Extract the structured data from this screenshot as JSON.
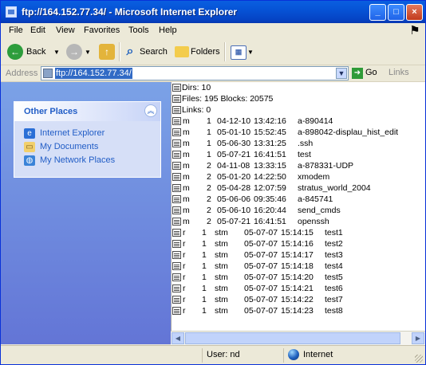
{
  "window": {
    "title": "ftp://164.152.77.34/ - Microsoft Internet Explorer"
  },
  "title_buttons": {
    "minimize": "_",
    "maximize": "□",
    "close": "×"
  },
  "menu": {
    "file": "File",
    "edit": "Edit",
    "view": "View",
    "favorites": "Favorites",
    "tools": "Tools",
    "help": "Help"
  },
  "toolbar": {
    "back": "Back",
    "search": "Search",
    "folders": "Folders"
  },
  "address": {
    "label": "Address",
    "value": "ftp://164.152.77.34/",
    "go": "Go",
    "links": "Links"
  },
  "left_panel": {
    "title": "Other Places",
    "links": [
      {
        "label": "Internet Explorer",
        "icon": "internet-explorer-icon"
      },
      {
        "label": "My Documents",
        "icon": "my-documents-icon"
      },
      {
        "label": "My Network Places",
        "icon": "network-places-icon"
      }
    ]
  },
  "listing": {
    "header_lines": [
      "Dirs: 10",
      "Files: 195  Blocks: 20575",
      "Links: 0"
    ],
    "entries": [
      {
        "type": "m",
        "count": "1",
        "owner": "",
        "date": "04-12-10",
        "time": "13:42:16",
        "name": "a-890414"
      },
      {
        "type": "m",
        "count": "1",
        "owner": "",
        "date": "05-01-10",
        "time": "15:52:45",
        "name": "a-898042-displau_hist_edit"
      },
      {
        "type": "m",
        "count": "1",
        "owner": "",
        "date": "05-06-30",
        "time": "13:31:25",
        "name": ".ssh"
      },
      {
        "type": "m",
        "count": "1",
        "owner": "",
        "date": "05-07-21",
        "time": "16:41:51",
        "name": "test"
      },
      {
        "type": "m",
        "count": "2",
        "owner": "",
        "date": "04-11-08",
        "time": "13:33:15",
        "name": "a-878331-UDP"
      },
      {
        "type": "m",
        "count": "2",
        "owner": "",
        "date": "05-01-20",
        "time": "14:22:50",
        "name": "xmodem"
      },
      {
        "type": "m",
        "count": "2",
        "owner": "",
        "date": "05-04-28",
        "time": "12:07:59",
        "name": "stratus_world_2004"
      },
      {
        "type": "m",
        "count": "2",
        "owner": "",
        "date": "05-06-06",
        "time": "09:35:46",
        "name": "a-845741"
      },
      {
        "type": "m",
        "count": "2",
        "owner": "",
        "date": "05-06-10",
        "time": "16:20:44",
        "name": "send_cmds"
      },
      {
        "type": "m",
        "count": "2",
        "owner": "",
        "date": "05-07-21",
        "time": "16:41:51",
        "name": "openssh"
      },
      {
        "type": "r",
        "count": "1",
        "owner": "stm",
        "date": "05-07-07",
        "time": "15:14:15",
        "name": "test1"
      },
      {
        "type": "r",
        "count": "1",
        "owner": "stm",
        "date": "05-07-07",
        "time": "15:14:16",
        "name": "test2"
      },
      {
        "type": "r",
        "count": "1",
        "owner": "stm",
        "date": "05-07-07",
        "time": "15:14:17",
        "name": "test3"
      },
      {
        "type": "r",
        "count": "1",
        "owner": "stm",
        "date": "05-07-07",
        "time": "15:14:18",
        "name": "test4"
      },
      {
        "type": "r",
        "count": "1",
        "owner": "stm",
        "date": "05-07-07",
        "time": "15:14:20",
        "name": "test5"
      },
      {
        "type": "r",
        "count": "1",
        "owner": "stm",
        "date": "05-07-07",
        "time": "15:14:21",
        "name": "test6"
      },
      {
        "type": "r",
        "count": "1",
        "owner": "stm",
        "date": "05-07-07",
        "time": "15:14:22",
        "name": "test7"
      },
      {
        "type": "r",
        "count": "1",
        "owner": "stm",
        "date": "05-07-07",
        "time": "15:14:23",
        "name": "test8"
      }
    ]
  },
  "status": {
    "user": "User: nd",
    "zone": "Internet"
  },
  "colors": {
    "title_bar": "#0653d6",
    "left_panel": "#7ba2e7",
    "selection": "#316ac5",
    "link": "#215dc6"
  }
}
